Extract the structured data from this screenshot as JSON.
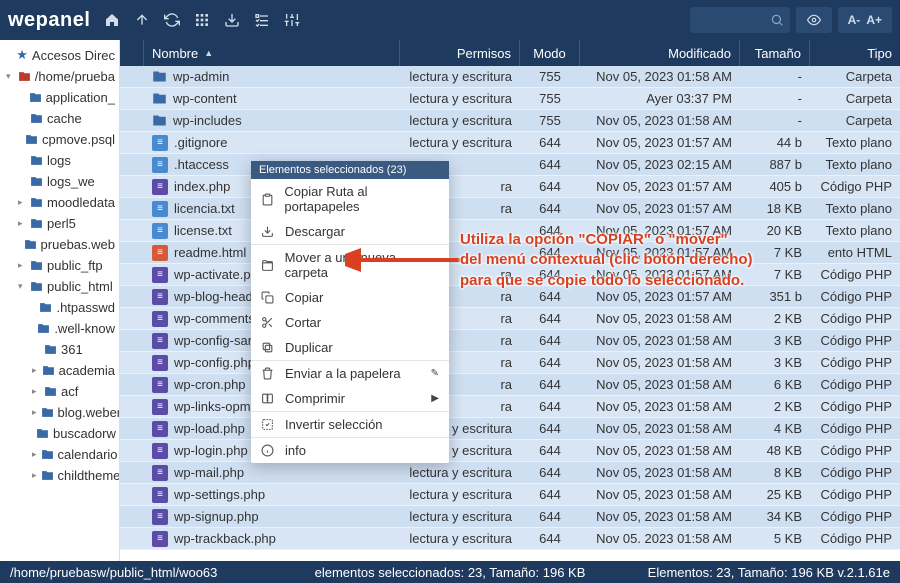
{
  "brand": "wepanel",
  "toolbar": {
    "font_minus": "A-",
    "font_plus": "A+"
  },
  "sidebar": [
    {
      "label": "Accesos Direc",
      "depth": 0,
      "caret": "",
      "icon": "star"
    },
    {
      "label": "/home/prueba",
      "depth": 0,
      "caret": "▾",
      "icon": "folder-red"
    },
    {
      "label": "application_",
      "depth": 1,
      "caret": "",
      "icon": "folder"
    },
    {
      "label": "cache",
      "depth": 1,
      "caret": "",
      "icon": "folder"
    },
    {
      "label": "cpmove.psql",
      "depth": 1,
      "caret": "",
      "icon": "folder"
    },
    {
      "label": "logs",
      "depth": 1,
      "caret": "",
      "icon": "folder"
    },
    {
      "label": "logs_we",
      "depth": 1,
      "caret": "",
      "icon": "folder"
    },
    {
      "label": "moodledata",
      "depth": 1,
      "caret": "▸",
      "icon": "folder"
    },
    {
      "label": "perl5",
      "depth": 1,
      "caret": "▸",
      "icon": "folder"
    },
    {
      "label": "pruebas.web",
      "depth": 1,
      "caret": "",
      "icon": "folder"
    },
    {
      "label": "public_ftp",
      "depth": 1,
      "caret": "▸",
      "icon": "folder"
    },
    {
      "label": "public_html",
      "depth": 1,
      "caret": "▾",
      "icon": "folder"
    },
    {
      "label": ".htpasswd",
      "depth": 2,
      "caret": "",
      "icon": "folder"
    },
    {
      "label": ".well-know",
      "depth": 2,
      "caret": "",
      "icon": "folder"
    },
    {
      "label": "361",
      "depth": 2,
      "caret": "",
      "icon": "folder"
    },
    {
      "label": "academia",
      "depth": 2,
      "caret": "▸",
      "icon": "folder"
    },
    {
      "label": "acf",
      "depth": 2,
      "caret": "▸",
      "icon": "folder"
    },
    {
      "label": "blog.weber",
      "depth": 2,
      "caret": "▸",
      "icon": "folder"
    },
    {
      "label": "buscadorw",
      "depth": 2,
      "caret": "",
      "icon": "folder"
    },
    {
      "label": "calendario",
      "depth": 2,
      "caret": "▸",
      "icon": "folder"
    },
    {
      "label": "childtheme",
      "depth": 2,
      "caret": "▸",
      "icon": "folder"
    }
  ],
  "columns": {
    "name": "Nombre",
    "perm": "Permisos",
    "mode": "Modo",
    "mod": "Modificado",
    "size": "Tamaño",
    "type": "Tipo"
  },
  "files": [
    {
      "name": "wp-admin",
      "icon": "folder",
      "perm": "lectura y escritura",
      "mode": "755",
      "mod": "Nov 05, 2023 01:58 AM",
      "size": "-",
      "type": "Carpeta"
    },
    {
      "name": "wp-content",
      "icon": "folder",
      "perm": "lectura y escritura",
      "mode": "755",
      "mod": "Ayer 03:37 PM",
      "size": "-",
      "type": "Carpeta"
    },
    {
      "name": "wp-includes",
      "icon": "folder",
      "perm": "lectura y escritura",
      "mode": "755",
      "mod": "Nov 05, 2023 01:58 AM",
      "size": "-",
      "type": "Carpeta"
    },
    {
      "name": ".gitignore",
      "icon": "txt",
      "perm": "lectura y escritura",
      "mode": "644",
      "mod": "Nov 05, 2023 01:57 AM",
      "size": "44 b",
      "type": "Texto plano"
    },
    {
      "name": ".htaccess",
      "icon": "txt",
      "perm": "",
      "mode": "644",
      "mod": "Nov 05, 2023 02:15 AM",
      "size": "887 b",
      "type": "Texto plano"
    },
    {
      "name": "index.php",
      "icon": "php",
      "perm": "ra",
      "mode": "644",
      "mod": "Nov 05, 2023 01:57 AM",
      "size": "405 b",
      "type": "Código PHP"
    },
    {
      "name": "licencia.txt",
      "icon": "txt",
      "perm": "ra",
      "mode": "644",
      "mod": "Nov 05, 2023 01:57 AM",
      "size": "18 KB",
      "type": "Texto plano"
    },
    {
      "name": "license.txt",
      "icon": "txt",
      "perm": "",
      "mode": "644",
      "mod": "Nov 05, 2023 01:57 AM",
      "size": "20 KB",
      "type": "Texto plano"
    },
    {
      "name": "readme.html",
      "icon": "html",
      "perm": "",
      "mode": "644",
      "mod": "Nov 05, 2023 01:57 AM",
      "size": "7 KB",
      "type": "ento HTML"
    },
    {
      "name": "wp-activate.php",
      "icon": "php",
      "perm": "ra",
      "mode": "644",
      "mod": "Nov 05, 2023 01:57 AM",
      "size": "7 KB",
      "type": "Código PHP"
    },
    {
      "name": "wp-blog-header.ph",
      "icon": "php",
      "perm": "ra",
      "mode": "644",
      "mod": "Nov 05, 2023 01:57 AM",
      "size": "351 b",
      "type": "Código PHP"
    },
    {
      "name": "wp-comments-pos",
      "icon": "php",
      "perm": "ra",
      "mode": "644",
      "mod": "Nov 05, 2023 01:58 AM",
      "size": "2 KB",
      "type": "Código PHP"
    },
    {
      "name": "wp-config-sample.",
      "icon": "php",
      "perm": "ra",
      "mode": "644",
      "mod": "Nov 05, 2023 01:58 AM",
      "size": "3 KB",
      "type": "Código PHP"
    },
    {
      "name": "wp-config.php",
      "icon": "php",
      "perm": "ra",
      "mode": "644",
      "mod": "Nov 05, 2023 01:58 AM",
      "size": "3 KB",
      "type": "Código PHP"
    },
    {
      "name": "wp-cron.php",
      "icon": "php",
      "perm": "ra",
      "mode": "644",
      "mod": "Nov 05, 2023 01:58 AM",
      "size": "6 KB",
      "type": "Código PHP"
    },
    {
      "name": "wp-links-opml.php",
      "icon": "php",
      "perm": "ra",
      "mode": "644",
      "mod": "Nov 05, 2023 01:58 AM",
      "size": "2 KB",
      "type": "Código PHP"
    },
    {
      "name": "wp-load.php",
      "icon": "php",
      "perm": "lectura y escritura",
      "mode": "644",
      "mod": "Nov 05, 2023 01:58 AM",
      "size": "4 KB",
      "type": "Código PHP"
    },
    {
      "name": "wp-login.php",
      "icon": "php",
      "perm": "lectura y escritura",
      "mode": "644",
      "mod": "Nov 05, 2023 01:58 AM",
      "size": "48 KB",
      "type": "Código PHP"
    },
    {
      "name": "wp-mail.php",
      "icon": "php",
      "perm": "lectura y escritura",
      "mode": "644",
      "mod": "Nov 05, 2023 01:58 AM",
      "size": "8 KB",
      "type": "Código PHP"
    },
    {
      "name": "wp-settings.php",
      "icon": "php",
      "perm": "lectura y escritura",
      "mode": "644",
      "mod": "Nov 05, 2023 01:58 AM",
      "size": "25 KB",
      "type": "Código PHP"
    },
    {
      "name": "wp-signup.php",
      "icon": "php",
      "perm": "lectura y escritura",
      "mode": "644",
      "mod": "Nov 05, 2023 01:58 AM",
      "size": "34 KB",
      "type": "Código PHP"
    },
    {
      "name": "wp-trackback.php",
      "icon": "php",
      "perm": "lectura y escritura",
      "mode": "644",
      "mod": "Nov 05. 2023 01:58 AM",
      "size": "5 KB",
      "type": "Código PHP"
    }
  ],
  "context_menu": {
    "header": "Elementos seleccionados (23)",
    "items": [
      {
        "label": "Copiar Ruta al portapapeles",
        "icon": "clipboard"
      },
      {
        "label": "Descargar",
        "icon": "download"
      },
      {
        "label": "Mover a una nueva carpeta",
        "icon": "move",
        "sep": true
      },
      {
        "label": "Copiar",
        "icon": "copy"
      },
      {
        "label": "Cortar",
        "icon": "cut"
      },
      {
        "label": "Duplicar",
        "icon": "duplicate"
      },
      {
        "label": "Enviar a la papelera",
        "icon": "trash",
        "sep": true,
        "edit": true
      },
      {
        "label": "Comprimir",
        "icon": "compress",
        "arrow": true
      },
      {
        "label": "Invertir selección",
        "icon": "invert",
        "sep": true
      },
      {
        "label": "info",
        "icon": "info",
        "sep": true
      }
    ]
  },
  "callout": {
    "line1": "Utiliza la opción \"COPIAR\" o \"mover\"",
    "line2": "del menú contextual (clic botón derecho)",
    "line3": "para que se copie todo lo seleccionado."
  },
  "status": {
    "path": "/home/pruebasw/public_html/woo63",
    "selection": "elementos seleccionados: 23, Tamaño: 196 KB",
    "right": "Elementos: 23, Tamaño: 196 KB v.2.1.61e"
  }
}
